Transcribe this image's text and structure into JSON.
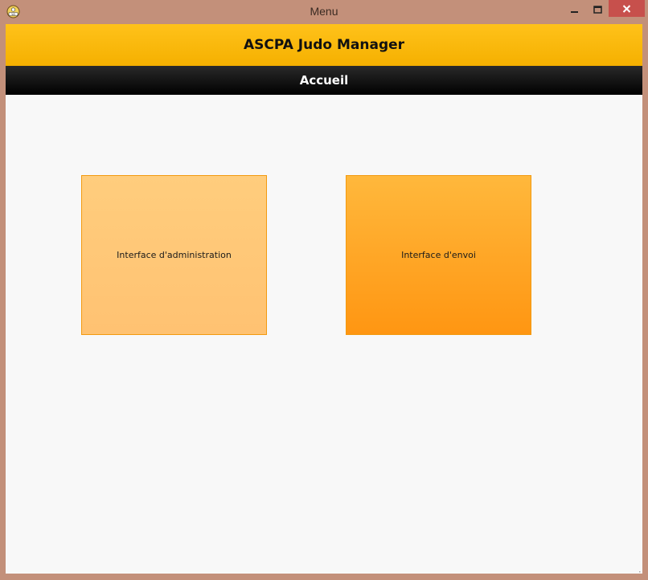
{
  "window": {
    "title": "Menu",
    "app_icon": "judo-app-icon",
    "controls": {
      "minimize": "minimize-icon",
      "maximize": "maximize-icon",
      "close": "close-icon"
    }
  },
  "header": {
    "title": "ASCPA Judo Manager"
  },
  "subheader": {
    "title": "Accueil"
  },
  "tiles": [
    {
      "label": "Interface d'administration"
    },
    {
      "label": "Interface d'envoi"
    }
  ],
  "colors": {
    "header_yellow": "#ffbe12",
    "close_red": "#c7504c",
    "tile_light_orange": "#ffc777",
    "tile_dark_orange": "#ffa623",
    "frame": "#c3907a"
  }
}
